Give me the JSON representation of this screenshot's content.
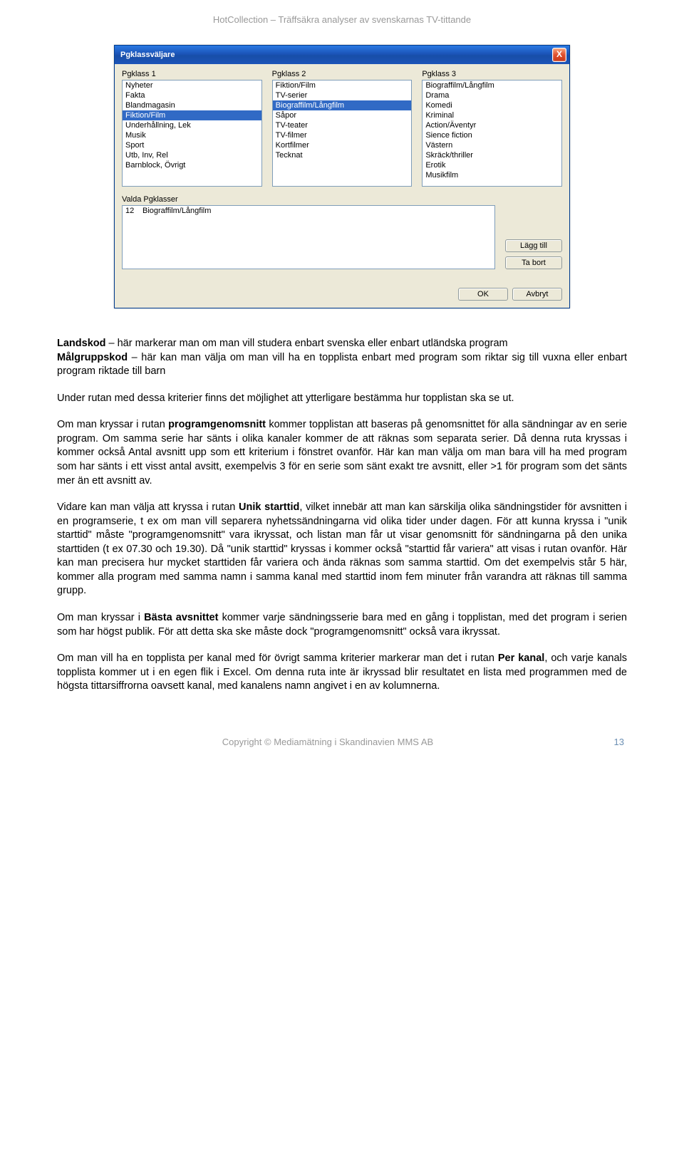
{
  "header": "HotCollection – Träffsäkra analyser av svenskarnas TV-tittande",
  "dialog": {
    "title": "Pgklassväljare",
    "close": "X",
    "col1_label": "Pgklass 1",
    "col2_label": "Pgklass 2",
    "col3_label": "Pgklass 3",
    "col1": [
      "Nyheter",
      "Fakta",
      "Blandmagasin",
      "Fiktion/Film",
      "Underhållning, Lek",
      "Musik",
      "Sport",
      "Utb, Inv, Rel",
      "Barnblock, Övrigt"
    ],
    "col1_selected_index": 3,
    "col2": [
      "Fiktion/Film",
      "TV-serier",
      "Biograffilm/Långfilm",
      "Såpor",
      "TV-teater",
      "TV-filmer",
      "Kortfilmer",
      "Tecknat"
    ],
    "col2_selected_index": 2,
    "col3": [
      "Biograffilm/Långfilm",
      "Drama",
      "Komedi",
      "Kriminal",
      "Action/Äventyr",
      "Sience fiction",
      "Västern",
      "Skräck/thriller",
      "Erotik",
      "Musikfilm"
    ],
    "valda_label": "Valda Pgklasser",
    "valda": [
      {
        "id": "12",
        "name": "Biograffilm/Långfilm"
      }
    ],
    "btn_add": "Lägg till",
    "btn_remove": "Ta bort",
    "btn_ok": "OK",
    "btn_cancel": "Avbryt"
  },
  "paragraphs": {
    "p1a": "Landskod",
    "p1b": " – här markerar man om man vill studera enbart svenska eller enbart utländska program",
    "p2a": "Målgruppskod",
    "p2b": " – här kan man välja om man vill ha en topplista enbart med program som riktar sig till vuxna eller enbart program riktade till barn",
    "p3": "Under rutan med dessa kriterier finns det möjlighet att ytterligare bestämma hur topplistan ska se ut.",
    "p4a": "Om man kryssar i rutan ",
    "p4b": "programgenomsnitt",
    "p4c": " kommer topplistan att baseras på genomsnittet för alla sändningar av en serie program. Om samma serie har sänts i olika kanaler kommer de att räknas som separata serier. Då denna ruta kryssas i kommer också Antal avsnitt upp som ett kriterium i fönstret ovanför. Här kan man välja om man bara vill ha med program som har sänts i ett visst antal avsitt, exempelvis 3 för en serie som sänt exakt tre avsnitt, eller >1 för program som det sänts mer än ett avsnitt av.",
    "p5a": "Vidare kan man välja att kryssa i rutan ",
    "p5b": "Unik starttid",
    "p5c": ", vilket innebär att man kan särskilja olika sändningstider för avsnitten i en programserie, t ex om man vill separera nyhetssändningarna vid olika tider under dagen. För att kunna kryssa i \"unik starttid\" måste \"programgenomsnitt\" vara ikryssat, och listan man får ut visar genomsnitt för sändningarna på den unika starttiden (t ex 07.30 och 19.30). Då \"unik starttid\" kryssas i kommer också \"starttid får variera\" att visas i rutan ovanför. Här kan man precisera hur mycket starttiden får variera och ända räknas som samma starttid. Om det exempelvis står 5 här, kommer alla program med samma namn i samma kanal med starttid inom fem minuter från varandra att räknas till samma grupp.",
    "p6a": "Om man kryssar i ",
    "p6b": "Bästa avsnittet",
    "p6c": " kommer varje sändningsserie bara med en gång i topplistan, med det program i serien som har högst publik. För att detta ska ske måste dock \"programgenomsnitt\" också vara ikryssat.",
    "p7a": "Om man vill ha en topplista per kanal med för övrigt samma kriterier markerar man det i rutan ",
    "p7b": "Per kanal",
    "p7c": ", och varje kanals topplista kommer ut i en egen flik i Excel. Om denna ruta inte är ikryssad blir resultatet en lista med programmen med de högsta tittarsiffrorna oavsett kanal, med kanalens namn angivet i en av kolumnerna."
  },
  "footer": {
    "copyright": "Copyright © Mediamätning i Skandinavien MMS AB",
    "page": "13"
  }
}
